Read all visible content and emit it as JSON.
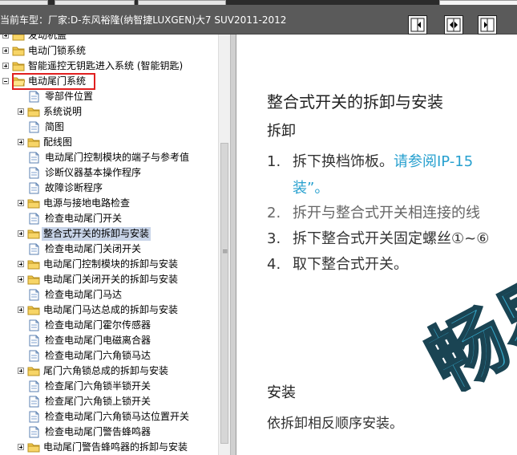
{
  "header": {
    "title": "当前车型：厂家:D-东风裕隆(纳智捷LUXGEN)大7 SUV2011-2012",
    "buttons": [
      {
        "name": "collapse-left-button",
        "icon": "arrow-left-icon"
      },
      {
        "name": "expand-both-button",
        "icon": "arrows-split-icon"
      },
      {
        "name": "expand-right-button",
        "icon": "arrow-right-icon"
      }
    ]
  },
  "tree": {
    "items": [
      {
        "label": "发动机盖",
        "level": 0,
        "type": "folder",
        "expander": "plus"
      },
      {
        "label": "电动门锁系统",
        "level": 0,
        "type": "folder",
        "expander": "plus"
      },
      {
        "label": "智能遥控无钥匙进入系统 (智能钥匙)",
        "level": 0,
        "type": "folder",
        "expander": "plus"
      },
      {
        "label": "电动尾门系统",
        "level": 0,
        "type": "folder-open",
        "expander": "minus",
        "highlighted": true
      },
      {
        "label": "零部件位置",
        "level": 1,
        "type": "doc"
      },
      {
        "label": "系统说明",
        "level": 1,
        "type": "folder",
        "expander": "plus"
      },
      {
        "label": "简图",
        "level": 1,
        "type": "doc"
      },
      {
        "label": "配线图",
        "level": 1,
        "type": "folder",
        "expander": "plus"
      },
      {
        "label": "电动尾门控制模块的端子与参考值",
        "level": 1,
        "type": "doc"
      },
      {
        "label": "诊断仪器基本操作程序",
        "level": 1,
        "type": "doc"
      },
      {
        "label": "故障诊断程序",
        "level": 1,
        "type": "doc"
      },
      {
        "label": "电源与接地电路检查",
        "level": 1,
        "type": "folder",
        "expander": "plus"
      },
      {
        "label": "检查电动尾门开关",
        "level": 1,
        "type": "doc"
      },
      {
        "label": "整合式开关的拆卸与安装",
        "level": 1,
        "type": "folder",
        "expander": "plus",
        "selected": true
      },
      {
        "label": "检查电动尾门关闭开关",
        "level": 1,
        "type": "doc"
      },
      {
        "label": "电动尾门控制模块的拆卸与安装",
        "level": 1,
        "type": "folder",
        "expander": "plus"
      },
      {
        "label": "电动尾门关闭开关的拆卸与安装",
        "level": 1,
        "type": "folder",
        "expander": "plus"
      },
      {
        "label": "检查电动尾门马达",
        "level": 1,
        "type": "doc"
      },
      {
        "label": "电动尾门马达总成的拆卸与安装",
        "level": 1,
        "type": "folder",
        "expander": "plus"
      },
      {
        "label": "检查电动尾门霍尔传感器",
        "level": 1,
        "type": "doc"
      },
      {
        "label": "检查电动尾门电磁离合器",
        "level": 1,
        "type": "doc"
      },
      {
        "label": "检查电动尾门六角锁马达",
        "level": 1,
        "type": "doc"
      },
      {
        "label": "尾门六角锁总成的拆卸与安装",
        "level": 1,
        "type": "folder",
        "expander": "plus"
      },
      {
        "label": "检查尾门六角锁半锁开关",
        "level": 1,
        "type": "doc"
      },
      {
        "label": "检查尾门六角锁上锁开关",
        "level": 1,
        "type": "doc"
      },
      {
        "label": "检查电动尾门六角锁马达位置开关",
        "level": 1,
        "type": "doc"
      },
      {
        "label": "检查电动尾门警告蜂鸣器",
        "level": 1,
        "type": "doc"
      },
      {
        "label": "电动尾门警告蜂鸣器的拆卸与安装",
        "level": 1,
        "type": "folder",
        "expander": "plus"
      }
    ]
  },
  "content": {
    "title": "整合式开关的拆卸与安装",
    "removal_heading": "拆卸",
    "steps": [
      {
        "num": "1.",
        "text": "拆下换档饰板。",
        "link": "请参阅IP-15",
        "cont": "装”。"
      },
      {
        "num": "2.",
        "text": "拆开与整合式开关相连接的线"
      },
      {
        "num": "3.",
        "text": "拆下整合式开关固定螺丝①~⑥"
      },
      {
        "num": "4.",
        "text": "取下整合式开关。"
      }
    ],
    "install_heading": "安装",
    "install_text": "依拆卸相反顺序安装。",
    "watermark": "畅易"
  },
  "colors": {
    "header_bg": "#5a5a5a",
    "link": "#27a0cf",
    "highlight_box": "#e02020",
    "selection": "#c8d4e8",
    "folder": "#f2c94c",
    "watermark": "#2aa3c7"
  }
}
